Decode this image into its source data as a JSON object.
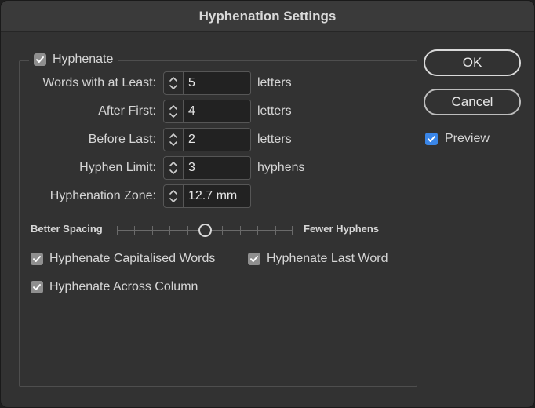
{
  "window": {
    "title": "Hyphenation Settings"
  },
  "hyphenate": {
    "label": "Hyphenate",
    "checked": true
  },
  "rows": [
    {
      "label": "Words with at Least:",
      "value": "5",
      "unit": "letters"
    },
    {
      "label": "After First:",
      "value": "4",
      "unit": "letters"
    },
    {
      "label": "Before Last:",
      "value": "2",
      "unit": "letters"
    },
    {
      "label": "Hyphen Limit:",
      "value": "3",
      "unit": "hyphens"
    },
    {
      "label": "Hyphenation Zone:",
      "value": "12.7 mm",
      "unit": ""
    }
  ],
  "slider": {
    "left_label": "Better Spacing",
    "right_label": "Fewer Hyphens",
    "position": 0.5
  },
  "options": {
    "capitalised": {
      "label": "Hyphenate Capitalised Words",
      "checked": true
    },
    "last_word": {
      "label": "Hyphenate Last Word",
      "checked": true
    },
    "across_column": {
      "label": "Hyphenate Across Column",
      "checked": true
    }
  },
  "buttons": {
    "ok": "OK",
    "cancel": "Cancel"
  },
  "preview": {
    "label": "Preview",
    "checked": true
  },
  "colors": {
    "accent": "#3a86e8",
    "checkbox_gray": "#8f8f8f",
    "background": "#323232"
  }
}
